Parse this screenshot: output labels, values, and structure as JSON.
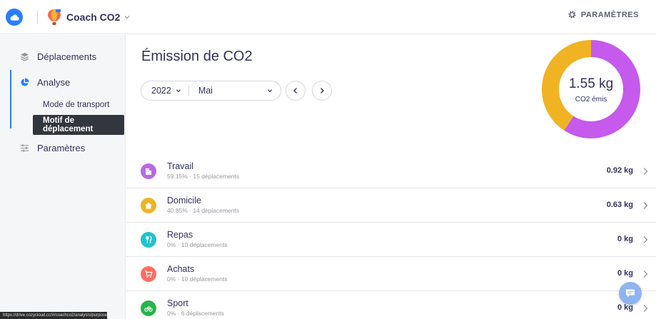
{
  "header": {
    "app_name": "Coach CO2",
    "settings_label": "PARAMÈTRES"
  },
  "sidebar": {
    "items": [
      {
        "label": "Déplacements",
        "icon": "layers-icon"
      },
      {
        "label": "Analyse",
        "icon": "pie-chart-icon"
      },
      {
        "label": "Paramètres",
        "icon": "sliders-icon"
      }
    ],
    "subitems": [
      {
        "label": "Mode de transport"
      },
      {
        "label": "Motif de déplacement",
        "selected": true
      }
    ],
    "status_url": "https://drive.cozycloud.cc/#/coachco2/analysis/purposes"
  },
  "main": {
    "title": "Émission de CO2",
    "year": "2022",
    "month": "Mai",
    "total_value": "1.55 kg",
    "total_label": "CO2 émis",
    "donut": [
      {
        "share": 59.15,
        "color": "#c55aec"
      },
      {
        "share": 40.85,
        "color": "#f0b323"
      }
    ],
    "rows": [
      {
        "title": "Travail",
        "sub": "59.15% · 15 déplacements",
        "value": "0.92 kg",
        "color": "#b76ae5",
        "icon": "building-icon"
      },
      {
        "title": "Domicile",
        "sub": "40.85% · 14 déplacements",
        "value": "0.63 kg",
        "color": "#f0b323",
        "icon": "home-icon"
      },
      {
        "title": "Repas",
        "sub": "0% · 10 déplacements",
        "value": "0 kg",
        "color": "#1fc3cc",
        "icon": "cutlery-icon"
      },
      {
        "title": "Achats",
        "sub": "0% · 10 déplacements",
        "value": "0 kg",
        "color": "#ff6d5e",
        "icon": "cart-icon"
      },
      {
        "title": "Sport",
        "sub": "0% · 6 déplacements",
        "value": "0 kg",
        "color": "#28b34c",
        "icon": "bike-icon"
      }
    ]
  }
}
